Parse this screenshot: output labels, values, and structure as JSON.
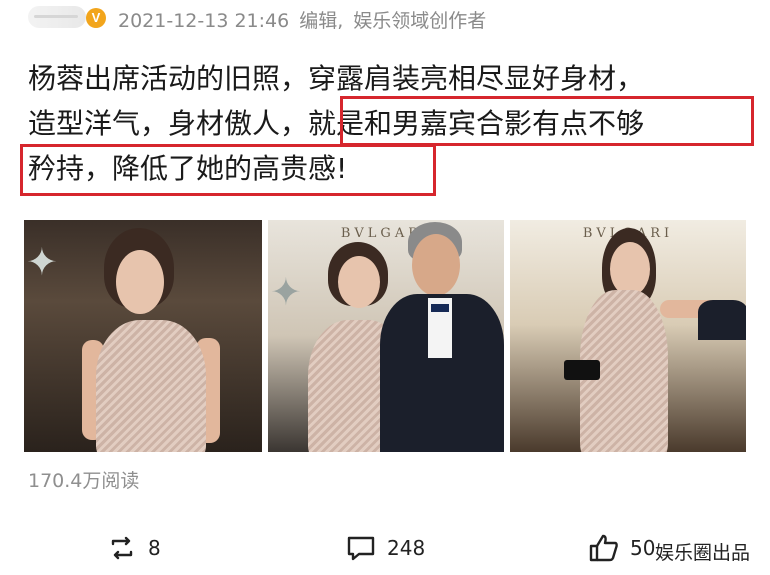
{
  "header": {
    "verified_badge": "V",
    "timestamp": "2021-12-13 21:46",
    "edited_label": "编辑,",
    "author_title": "娱乐领域创作者"
  },
  "article": {
    "lines": [
      "杨蓉出席活动的旧照，穿露肩装亮相尽显好身材，",
      "造型洋气，身材傲人，就是和男嘉宾合影有点不够",
      "矜持，降低了她的高贵感!"
    ],
    "highlight_color": "#d6262d"
  },
  "photos": {
    "captions": [
      "",
      "BVLGARI",
      "BVLGARI"
    ]
  },
  "stats": {
    "read_count": "170.4万阅读"
  },
  "actions": {
    "repost_count": "8",
    "comment_count": "248",
    "like_count": "50"
  },
  "watermark": "娱乐圈出品",
  "icons": {
    "repost": "repost-icon",
    "comment": "comment-icon",
    "like": "thumbs-up-icon"
  }
}
